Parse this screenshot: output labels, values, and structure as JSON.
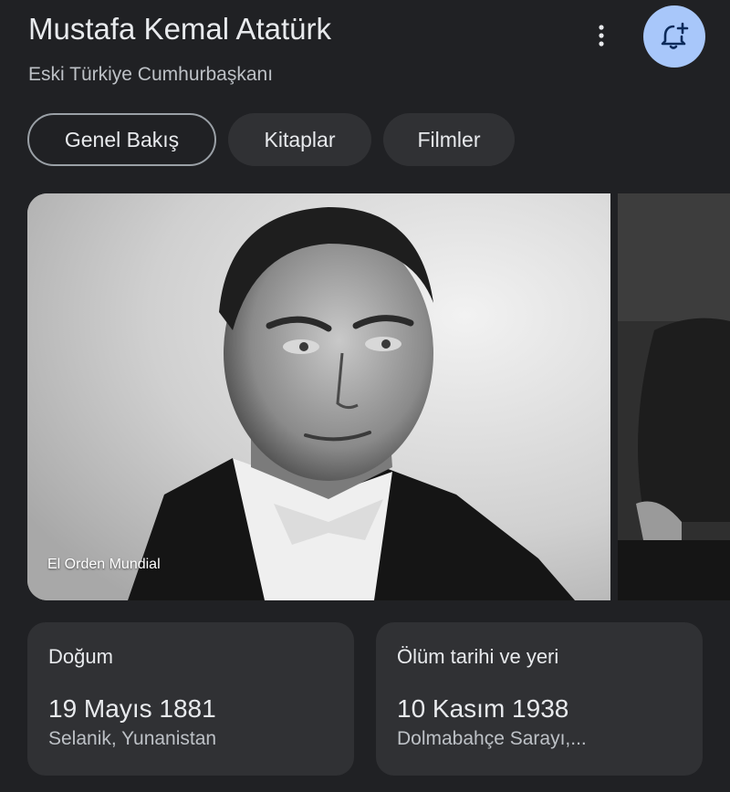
{
  "header": {
    "title": "Mustafa Kemal Atatürk",
    "subtitle": "Eski Türkiye Cumhurbaşkanı",
    "more_icon": "more-vert-icon",
    "follow_icon": "bell-plus-icon",
    "follow_color": "#a8c7fa"
  },
  "tabs": [
    {
      "label": "Genel Bakış",
      "active": true
    },
    {
      "label": "Kitaplar",
      "active": false
    },
    {
      "label": "Filmler",
      "active": false
    }
  ],
  "images": {
    "main_caption": "El Orden Mundial"
  },
  "cards": [
    {
      "label": "Doğum",
      "value": "19 Mayıs 1881",
      "sub": "Selanik, Yunanistan"
    },
    {
      "label": "Ölüm tarihi ve yeri",
      "value": "10 Kasım 1938",
      "sub": "Dolmabahçe Sarayı,..."
    }
  ]
}
